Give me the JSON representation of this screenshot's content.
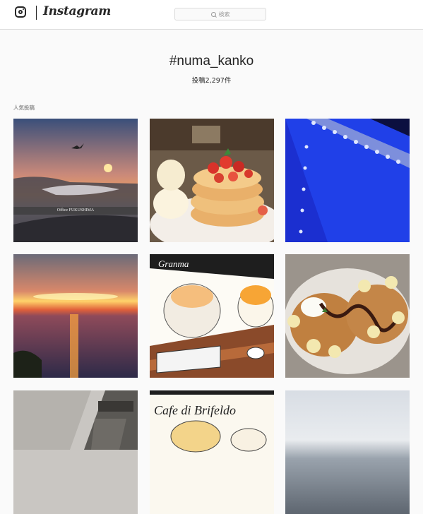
{
  "header": {
    "wordmark": "Instagram",
    "search_placeholder": "検索",
    "icons": [
      "instagram-camera-icon",
      "search-icon"
    ]
  },
  "tag": {
    "title": "#numa_kanko",
    "post_count": "投稿2,297件"
  },
  "section": {
    "label": "人気投稿"
  },
  "posts": [
    {
      "subject": "seaside-sunset-bird",
      "overlay_text": "Office FUKUSHIMA"
    },
    {
      "subject": "strawberry-pancakes"
    },
    {
      "subject": "blue-steel-rivets"
    },
    {
      "subject": "sea-sunset"
    },
    {
      "subject": "kakigori-illustration",
      "overlay_text": "Granma"
    },
    {
      "subject": "banana-chocolate-pancakes"
    },
    {
      "subject": "tower-sky"
    },
    {
      "subject": "cafe-illustration",
      "overlay_text": "Cafe di Brifeldo"
    },
    {
      "subject": "misty-sea"
    }
  ],
  "colors": {
    "background": "#fafafa",
    "header": "#ffffff",
    "border": "#dbdbdb",
    "text": "#262626",
    "muted": "#999999"
  }
}
